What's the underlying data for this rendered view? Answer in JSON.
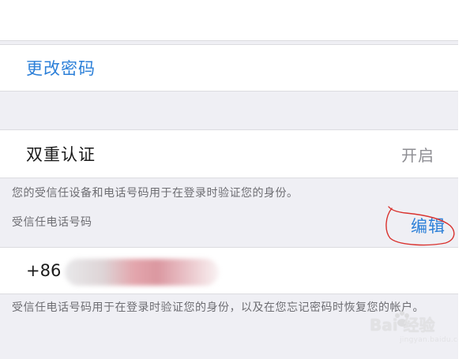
{
  "security": {
    "change_password": "更改密码",
    "two_factor": {
      "label": "双重认证",
      "value": "开启"
    },
    "trusted_devices_note": "您的受信任设备和电话号码用于在登录时验证您的身份。",
    "trusted_phone_header": "受信任电话号码",
    "edit_label": "编辑",
    "phone": {
      "country_code": "+86"
    },
    "trusted_phone_note": "受信任电话号码用于在登录时验证您的身份，以及在您忘记密码时恢复您的帐户。"
  },
  "watermark": {
    "brand": "Bai  经验",
    "url": "jingyan.baidu.com"
  },
  "colors": {
    "accent": "#2b7fd8",
    "background": "#efeff4",
    "annotation": "#d9302c"
  },
  "icons": {
    "edit_highlight": "hand-drawn-red-circle",
    "watermark_logo": "baidu-paw-icon"
  }
}
